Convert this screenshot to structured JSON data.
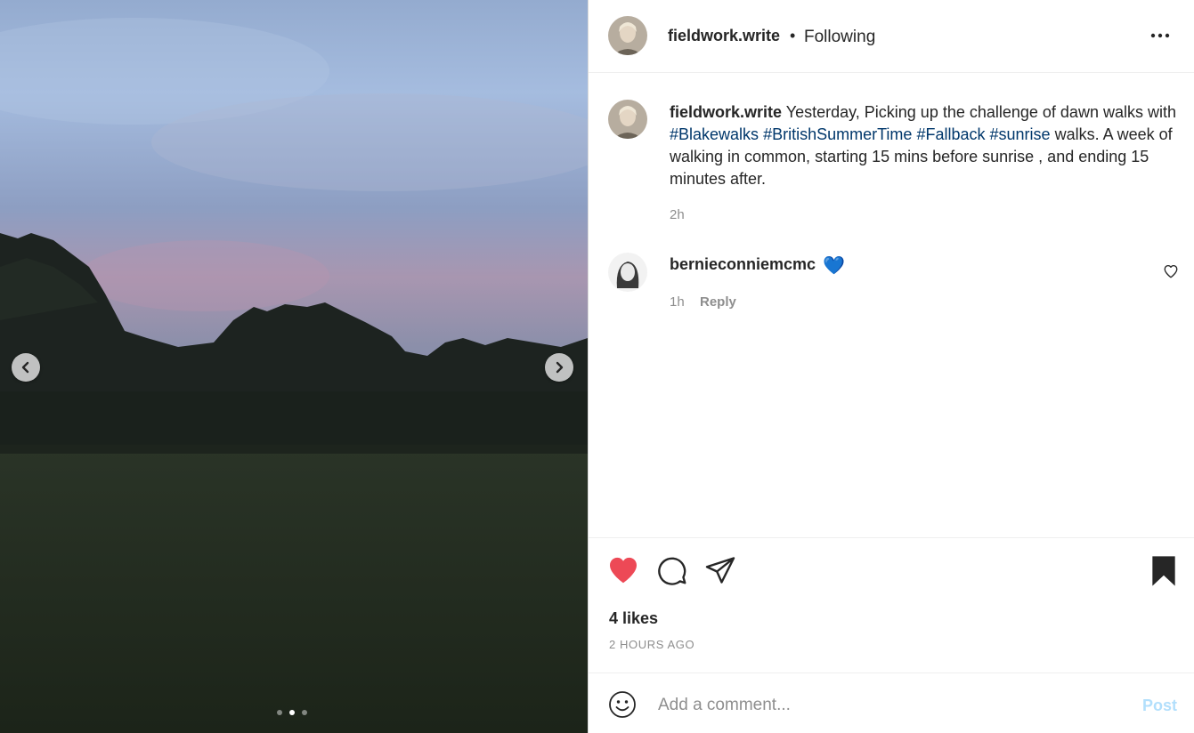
{
  "post": {
    "username": "fieldwork.write",
    "follow_separator": "•",
    "follow_status": "Following",
    "caption_before": "Yesterday, Picking up the challenge of dawn walks with",
    "hashtags": [
      "#Blakewalks",
      "#BritishSummerTime",
      "#Fallback",
      "#sunrise"
    ],
    "caption_after": "walks. A week of walking in common, starting 15 mins before sunrise , and ending 15 minutes after.",
    "caption_time": "2h"
  },
  "comments": [
    {
      "username": "bernieconniemcmc",
      "text": "💙",
      "time": "1h",
      "reply_label": "Reply"
    }
  ],
  "carousel": {
    "slide_count": 3,
    "active_index": 1
  },
  "actions": {
    "liked": true,
    "saved": true,
    "likes_label": "4 likes",
    "timestamp": "2 HOURS AGO"
  },
  "comment_box": {
    "placeholder": "Add a comment...",
    "post_label": "Post"
  },
  "colors": {
    "like_red": "#ed4956",
    "hashtag": "#00376b",
    "post_disabled": "#b2dffc",
    "heart_blue": "#1877f2"
  },
  "icons": [
    "more-options-icon",
    "chevron-left-icon",
    "chevron-right-icon",
    "heart-icon",
    "comment-icon",
    "share-icon",
    "bookmark-icon",
    "smiley-icon"
  ]
}
